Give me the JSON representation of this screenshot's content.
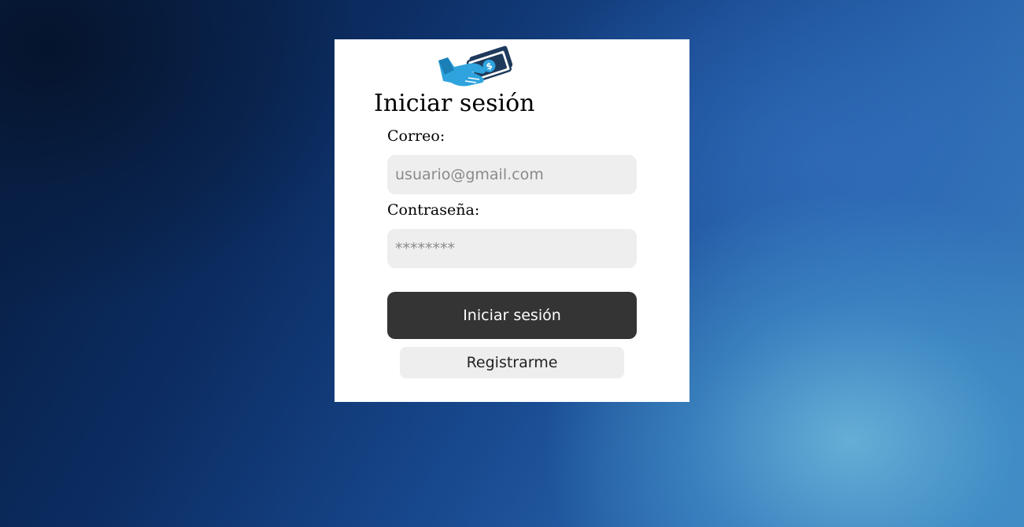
{
  "login": {
    "logo_icon": "handshake-money-icon",
    "title": "Iniciar sesión",
    "email_label": "Correo:",
    "email_placeholder": "usuario@gmail.com",
    "email_value": "",
    "password_label": "Contraseña:",
    "password_placeholder": "********",
    "password_value": "",
    "submit_label": "Iniciar sesión",
    "register_label": "Registrarme"
  },
  "colors": {
    "card_background": "#ffffff",
    "input_background": "#eeeeee",
    "primary_button": "#343434",
    "logo_accent": "#2ea3dd",
    "logo_dark": "#1e3a5c"
  }
}
